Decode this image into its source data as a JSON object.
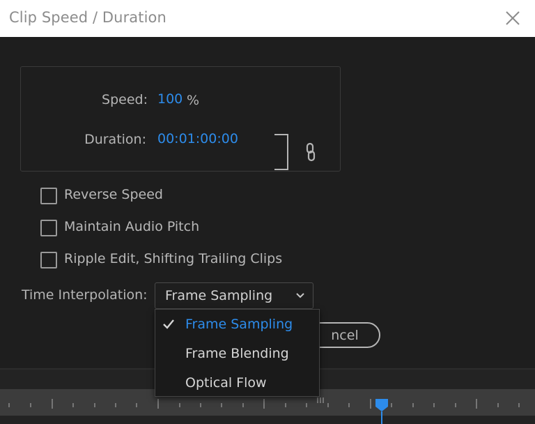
{
  "window": {
    "title": "Clip Speed / Duration",
    "close_icon": "close-icon"
  },
  "speed_box": {
    "speed_label": "Speed:",
    "speed_value": "100",
    "speed_unit": "%",
    "duration_label": "Duration:",
    "duration_value": "00:01:00:00",
    "link_icon": "link-icon"
  },
  "options": {
    "checkboxes": [
      {
        "label": "Reverse Speed",
        "checked": false
      },
      {
        "label": "Maintain Audio Pitch",
        "checked": false
      },
      {
        "label": "Ripple Edit, Shifting Trailing Clips",
        "checked": false
      }
    ]
  },
  "interpolation": {
    "label": "Time Interpolation:",
    "selected": "Frame Sampling",
    "options": [
      {
        "label": "Frame Sampling",
        "selected": true
      },
      {
        "label": "Frame Blending",
        "selected": false
      },
      {
        "label": "Optical Flow",
        "selected": false
      }
    ]
  },
  "buttons": {
    "cancel_visible_text": "ncel"
  },
  "colors": {
    "accent": "#2d8ceb",
    "background": "#1e1e1e",
    "titlebar": "#ffffff"
  }
}
